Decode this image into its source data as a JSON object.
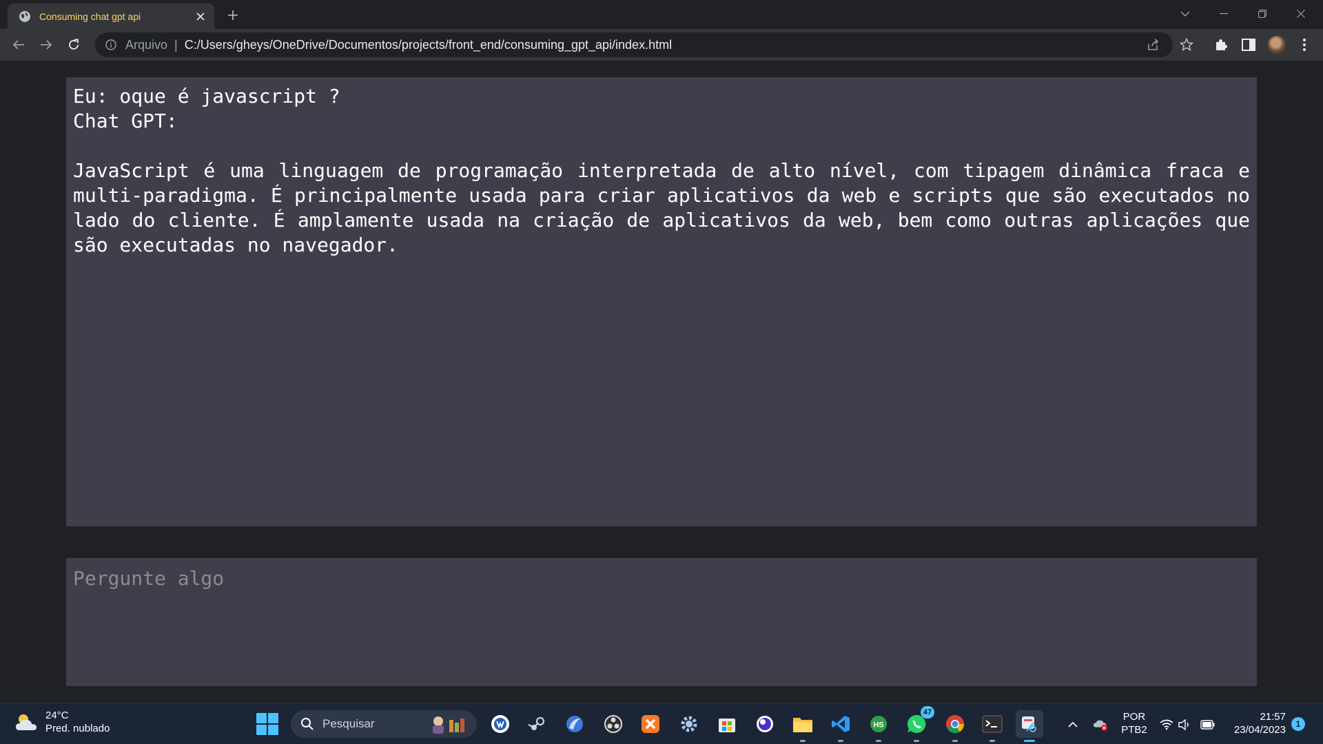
{
  "browser": {
    "tab": {
      "title": "Consuming chat gpt api"
    },
    "address": {
      "scheme_label": "Arquivo",
      "separator": "|",
      "url": "C:/Users/gheys/OneDrive/Documentos/projects/front_end/consuming_gpt_api/index.html"
    }
  },
  "chat": {
    "user_line": "Eu: oque é javascript ?",
    "bot_label": "Chat GPT:",
    "answer": "JavaScript é uma linguagem de programação interpretada de alto nível, com tipagem dinâmica fraca e multi-paradigma. É principalmente usada para criar aplicativos da web e scripts que são executados no lado do cliente. É amplamente usada na criação de aplicativos da web, bem como outras aplicações que são executadas no navegador."
  },
  "prompt": {
    "placeholder": "Pergunte algo",
    "value": ""
  },
  "taskbar": {
    "weather": {
      "temp": "24°C",
      "condition": "Pred. nublado"
    },
    "search_label": "Pesquisar",
    "apps": [
      {
        "name": "widget-app-icon"
      },
      {
        "name": "steam-icon"
      },
      {
        "name": "browser-app-icon"
      },
      {
        "name": "obs-icon"
      },
      {
        "name": "xampp-icon"
      },
      {
        "name": "settings-gear-icon"
      },
      {
        "name": "microsoft-store-icon"
      },
      {
        "name": "app-circle-icon"
      },
      {
        "name": "file-explorer-icon"
      },
      {
        "name": "vscode-icon"
      },
      {
        "name": "hs-app-icon"
      },
      {
        "name": "whatsapp-icon",
        "badge": "47"
      },
      {
        "name": "chrome-icon"
      },
      {
        "name": "terminal-icon"
      },
      {
        "name": "snipping-tool-icon"
      }
    ],
    "tray": {
      "language": "POR",
      "layout": "PTB2",
      "time": "21:57",
      "date": "23/04/2023",
      "notification_count": "1"
    }
  },
  "colors": {
    "page_bg": "#202124",
    "panel_bg": "#3e3f4b",
    "tab_title": "#fdd663",
    "accent": "#4cc2ff"
  }
}
